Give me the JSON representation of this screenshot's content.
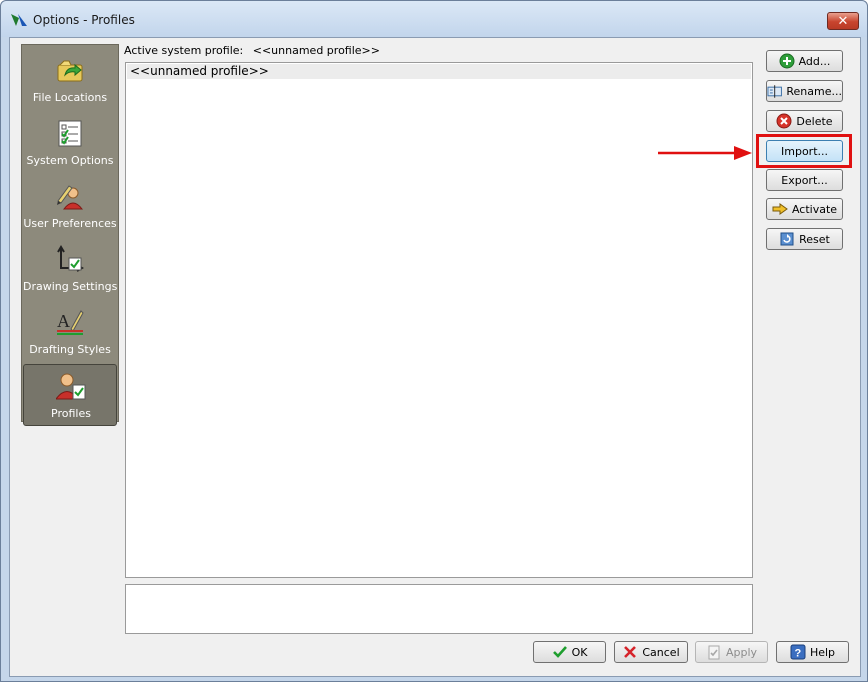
{
  "window": {
    "title": "Options - Profiles",
    "close_glyph": "✕"
  },
  "nav": {
    "items": [
      {
        "label": "File Locations",
        "icon": "folder-arrow-icon"
      },
      {
        "label": "System Options",
        "icon": "checklist-icon"
      },
      {
        "label": "User Preferences",
        "icon": "user-pencil-icon"
      },
      {
        "label": "Drawing Settings",
        "icon": "drawing-settings-icon"
      },
      {
        "label": "Drafting Styles",
        "icon": "drafting-styles-icon"
      },
      {
        "label": "Profiles",
        "icon": "user-profile-icon",
        "active": true
      }
    ]
  },
  "profile": {
    "active_label": "Active system profile:",
    "active_value": "<<unnamed profile>>",
    "list": [
      "<<unnamed profile>>"
    ],
    "description": ""
  },
  "side_buttons": {
    "add": "Add...",
    "rename": "Rename...",
    "delete": "Delete",
    "import": "Import...",
    "export": "Export...",
    "activate": "Activate",
    "reset": "Reset"
  },
  "footer_buttons": {
    "ok": "OK",
    "cancel": "Cancel",
    "apply": "Apply",
    "help": "Help"
  },
  "colors": {
    "highlight": "#e01010",
    "nav_background": "#8d8a7c",
    "window_frame": "#c5d6ea"
  }
}
